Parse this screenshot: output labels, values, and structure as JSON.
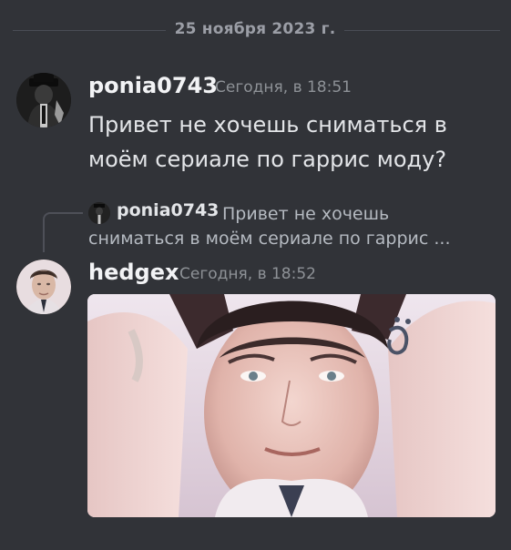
{
  "date_divider": "25 ноября 2023 г.",
  "messages": [
    {
      "author": "ponia0743",
      "timestamp": "Сегодня, в 18:51",
      "text": "Привет не хочешь сниматься в моём сериале по гаррис моду?"
    },
    {
      "reply": {
        "author": "ponia0743",
        "text": "Привет не хочешь сниматься в моём сериале по гаррис ..."
      },
      "author": "hedgex",
      "timestamp": "Сегодня, в 18:52",
      "attachment": "image"
    }
  ]
}
